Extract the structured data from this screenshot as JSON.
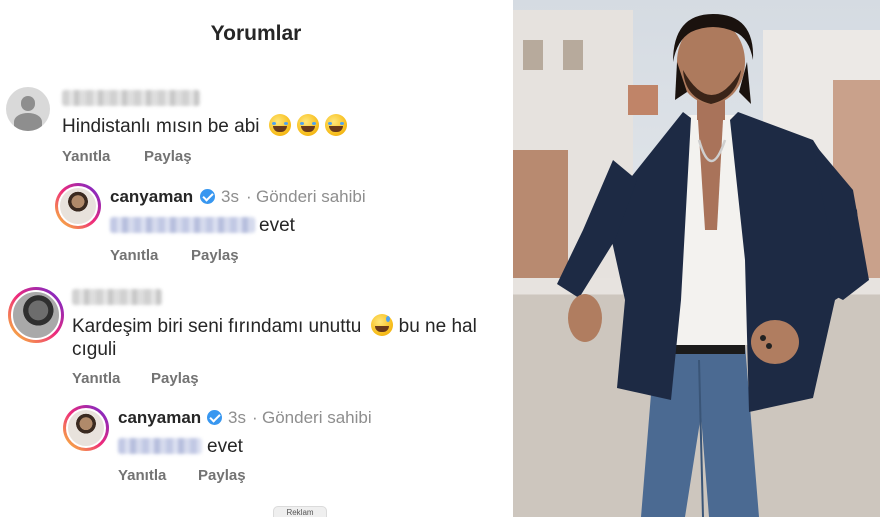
{
  "header": {
    "title": "Yorumlar"
  },
  "comments": [
    {
      "text": "Hindistanlı mısın be abi",
      "emoji_count": 3,
      "actions": {
        "reply": "Yanıtla",
        "share": "Paylaş"
      },
      "reply": {
        "username": "canyaman",
        "verified": true,
        "time": "3s",
        "separator": "·",
        "owner_label": "Gönderi sahibi",
        "text": "evet",
        "actions": {
          "reply": "Yanıtla",
          "share": "Paylaş"
        }
      }
    },
    {
      "text_line1": "Kardeşim biri seni fırındamı unuttu",
      "text_line1_tail": "bu ne hal",
      "text_line2": "cıguli",
      "actions": {
        "reply": "Yanıtla",
        "share": "Paylaş"
      },
      "reply": {
        "username": "canyaman",
        "verified": true,
        "time": "3s",
        "separator": "·",
        "owner_label": "Gönderi sahibi",
        "text": "evet",
        "actions": {
          "reply": "Yanıtla",
          "share": "Paylaş"
        }
      }
    }
  ],
  "footer": {
    "pill_label": "Reklam"
  },
  "colors": {
    "verified": "#3897f0",
    "secondary_text": "#8e8e8e",
    "action_text": "#737373",
    "jacket": "#1d2a44",
    "jeans": "#4b6a92"
  },
  "icons": [
    "default-avatar-icon",
    "verified-badge-icon",
    "tears-of-joy-emoji",
    "grinning-sweat-emoji"
  ]
}
